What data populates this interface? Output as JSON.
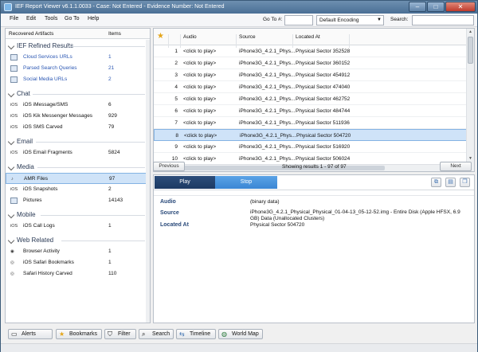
{
  "window": {
    "title": "IEF Report Viewer v6.1.1.0033 - Case: Not Entered - Evidence Number: Not Entered",
    "min": "–",
    "max": "□",
    "close": "✕"
  },
  "menu": {
    "file": "File",
    "edit": "Edit",
    "tools": "Tools",
    "goto": "Go To",
    "help": "Help"
  },
  "toolbar": {
    "goto_label": "Go To #:",
    "goto_value": "",
    "encoding": "Default Encoding",
    "search_label": "Search:",
    "search_value": ""
  },
  "left": {
    "col_artifacts": "Recovered Artifacts",
    "col_items": "Items",
    "groups": [
      {
        "title": "IEF Refined Results",
        "items": [
          {
            "label": "Cloud Services URLs",
            "count": "1"
          },
          {
            "label": "Parsed Search Queries",
            "count": "21"
          },
          {
            "label": "Social Media URLs",
            "count": "2"
          }
        ]
      },
      {
        "title": "Chat",
        "items": [
          {
            "label": "iOS iMessage/SMS",
            "count": "6",
            "prefix": "iOS"
          },
          {
            "label": "iOS Kik Messenger Messages",
            "count": "929",
            "prefix": "iOS"
          },
          {
            "label": "iOS SMS Carved",
            "count": "79",
            "prefix": "iOS"
          }
        ]
      },
      {
        "title": "Email",
        "items": [
          {
            "label": "iOS Email Fragments",
            "count": "5824",
            "prefix": "iOS"
          }
        ]
      },
      {
        "title": "Media",
        "items": [
          {
            "label": "AMR Files",
            "count": "97"
          },
          {
            "label": "iOS Snapshots",
            "count": "2",
            "prefix": "iOS"
          },
          {
            "label": "Pictures",
            "count": "14143"
          }
        ]
      },
      {
        "title": "Mobile",
        "items": [
          {
            "label": "iOS Call Logs",
            "count": "1",
            "prefix": "iOS"
          }
        ]
      },
      {
        "title": "Web Related",
        "items": [
          {
            "label": "Browser Activity",
            "count": "1"
          },
          {
            "label": "iOS Safari Bookmarks",
            "count": "1"
          },
          {
            "label": "Safari History Carved",
            "count": "110"
          }
        ]
      }
    ]
  },
  "grid": {
    "col_audio": "Audio",
    "col_source": "Source",
    "col_location": "Located At",
    "rows": [
      {
        "n": "1",
        "audio": "<click to play>",
        "source": "iPhone3G_4.2.1_Phys...",
        "loc": "Physical Sector 352528"
      },
      {
        "n": "2",
        "audio": "<click to play>",
        "source": "iPhone3G_4.2.1_Phys...",
        "loc": "Physical Sector 360152"
      },
      {
        "n": "3",
        "audio": "<click to play>",
        "source": "iPhone3G_4.2.1_Phys...",
        "loc": "Physical Sector 454912"
      },
      {
        "n": "4",
        "audio": "<click to play>",
        "source": "iPhone3G_4.2.1_Phys...",
        "loc": "Physical Sector 474040"
      },
      {
        "n": "5",
        "audio": "<click to play>",
        "source": "iPhone3G_4.2.1_Phys...",
        "loc": "Physical Sector 462752"
      },
      {
        "n": "6",
        "audio": "<click to play>",
        "source": "iPhone3G_4.2.1_Phys...",
        "loc": "Physical Sector 484744"
      },
      {
        "n": "7",
        "audio": "<click to play>",
        "source": "iPhone3G_4.2.1_Phys...",
        "loc": "Physical Sector 511936"
      },
      {
        "n": "8",
        "audio": "<click to play>",
        "source": "iPhone3G_4.2.1_Phys...",
        "loc": "Physical Sector 504720"
      },
      {
        "n": "9",
        "audio": "<click to play>",
        "source": "iPhone3G_4.2.1_Phys...",
        "loc": "Physical Sector 516920"
      },
      {
        "n": "10",
        "audio": "<click to play>",
        "source": "iPhone3G_4.2.1_Phys...",
        "loc": "Physical Sector 506024"
      }
    ],
    "selected_index": 7
  },
  "pager": {
    "prev": "Previous",
    "next": "Next",
    "info": "Showing results 1 - 97 of 97"
  },
  "detail": {
    "play": "Play",
    "stop": "Stop",
    "audio_label": "Audio",
    "audio_value": "(binary data)",
    "source_label": "Source",
    "source_value": "iPhone3G_4.2.1_Physical_Physical_01-04-13_05-12-52.img - Entire Disk (Apple HFSX, 6.9 GB) Data (Unallocated Clusters)",
    "located_label": "Located At",
    "located_value": "Physical Sector 504720"
  },
  "bottom": {
    "alerts": "Alerts",
    "bookmarks": "Bookmarks",
    "filter": "Filter",
    "search": "Search",
    "timeline": "Timeline",
    "worldmap": "World Map"
  }
}
